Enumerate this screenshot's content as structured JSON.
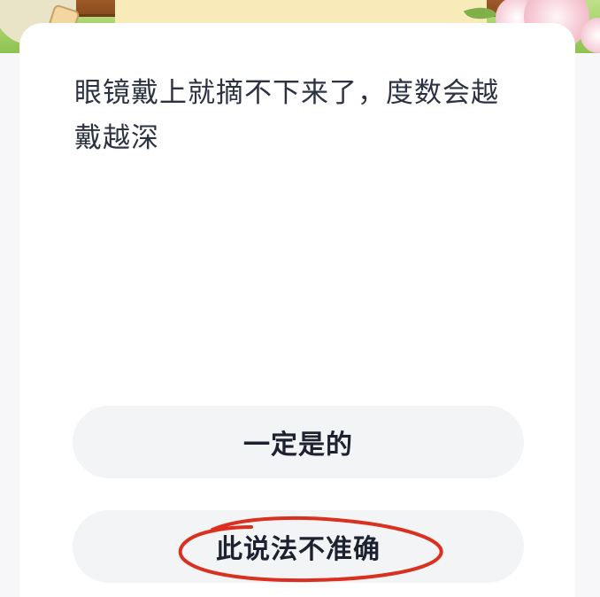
{
  "question": {
    "text": "眼镜戴上就摘不下来了，度数会越戴越深"
  },
  "options": [
    {
      "label": "一定是的"
    },
    {
      "label": "此说法不准确"
    }
  ],
  "annotation": {
    "color": "#d9301f",
    "marks": "hand-drawn red ellipse around second option"
  }
}
